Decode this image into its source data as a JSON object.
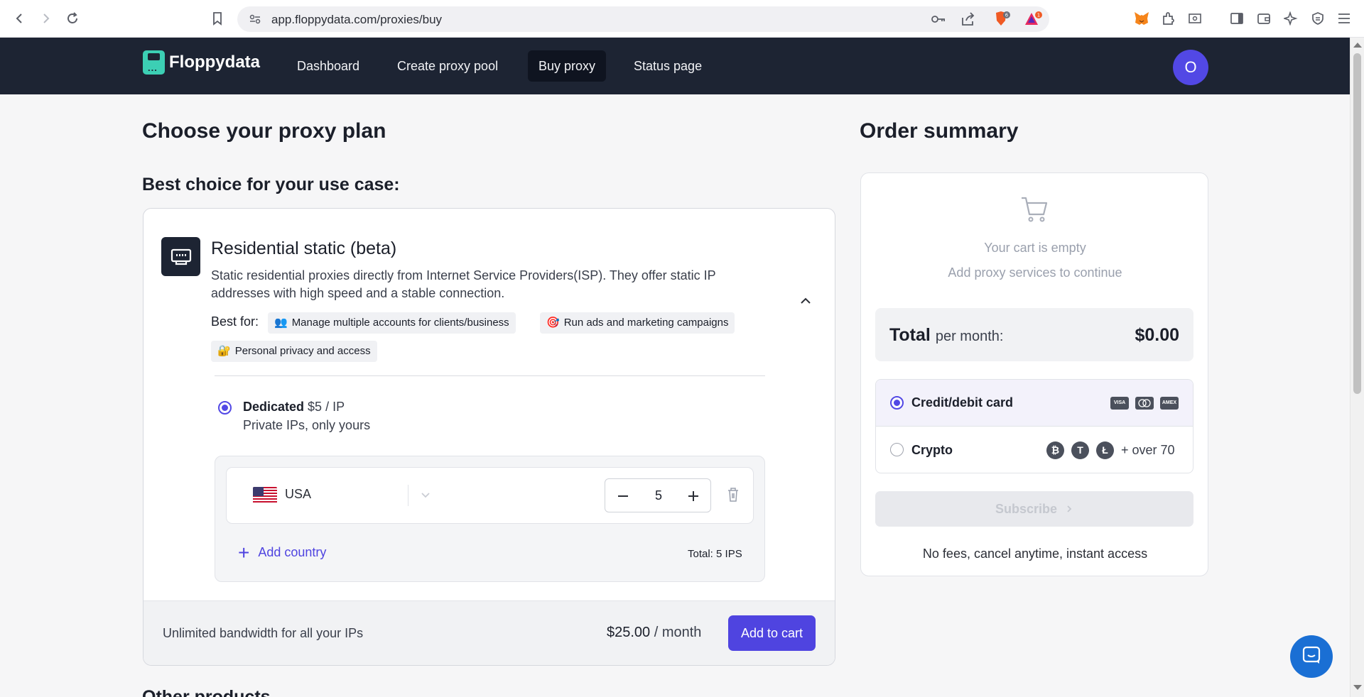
{
  "browser": {
    "url": "app.floppydata.com/proxies/buy",
    "brave_badge": "6",
    "rewards_badge": "1"
  },
  "nav": {
    "brand": "Floppydata",
    "links": [
      "Dashboard",
      "Create proxy pool",
      "Buy proxy",
      "Status page"
    ],
    "active": "Buy proxy",
    "avatar_initial": "O"
  },
  "main": {
    "title": "Choose your proxy plan",
    "subtitle": "Best choice for your use case:",
    "plan": {
      "title": "Residential static (beta)",
      "description": "Static residential proxies directly from Internet Service Providers(ISP). They offer static IP addresses with high speed and a stable connection.",
      "best_for_label": "Best for:",
      "tags": [
        {
          "emoji": "👥",
          "label": "Manage multiple accounts for clients/business"
        },
        {
          "emoji": "🎯",
          "label": "Run ads and marketing campaigns"
        },
        {
          "emoji": "🔐",
          "label": "Personal privacy and access"
        }
      ],
      "option": {
        "name": "Dedicated",
        "price": "$5 / IP",
        "subtitle": "Private IPs, only yours"
      },
      "country": {
        "name": "USA",
        "quantity": "5"
      },
      "add_country": "Add country",
      "total_ips": "Total: 5 IPS",
      "footer_text": "Unlimited bandwidth for all your IPs",
      "footer_price": "$25.00",
      "footer_per": "/ month",
      "add_to_cart": "Add to cart"
    },
    "other_products": "Other products"
  },
  "summary": {
    "title": "Order summary",
    "empty": "Your cart is empty",
    "hint": "Add proxy services to continue",
    "total_label": "Total",
    "total_per": "per month:",
    "total_amount": "$0.00",
    "payment": {
      "card_label": "Credit/debit card",
      "card_logos": [
        "VISA",
        "MC",
        "AMEX"
      ],
      "crypto_label": "Crypto",
      "crypto_coins": [
        "₿",
        "T",
        "Ł"
      ],
      "crypto_more": "+ over 70"
    },
    "subscribe": "Subscribe",
    "footer": "No fees, cancel anytime, instant access"
  },
  "colors": {
    "accent": "#4f44e0",
    "nav_bg": "#1d2433",
    "logo": "#3ccfb4",
    "chat": "#1a6fd4"
  }
}
